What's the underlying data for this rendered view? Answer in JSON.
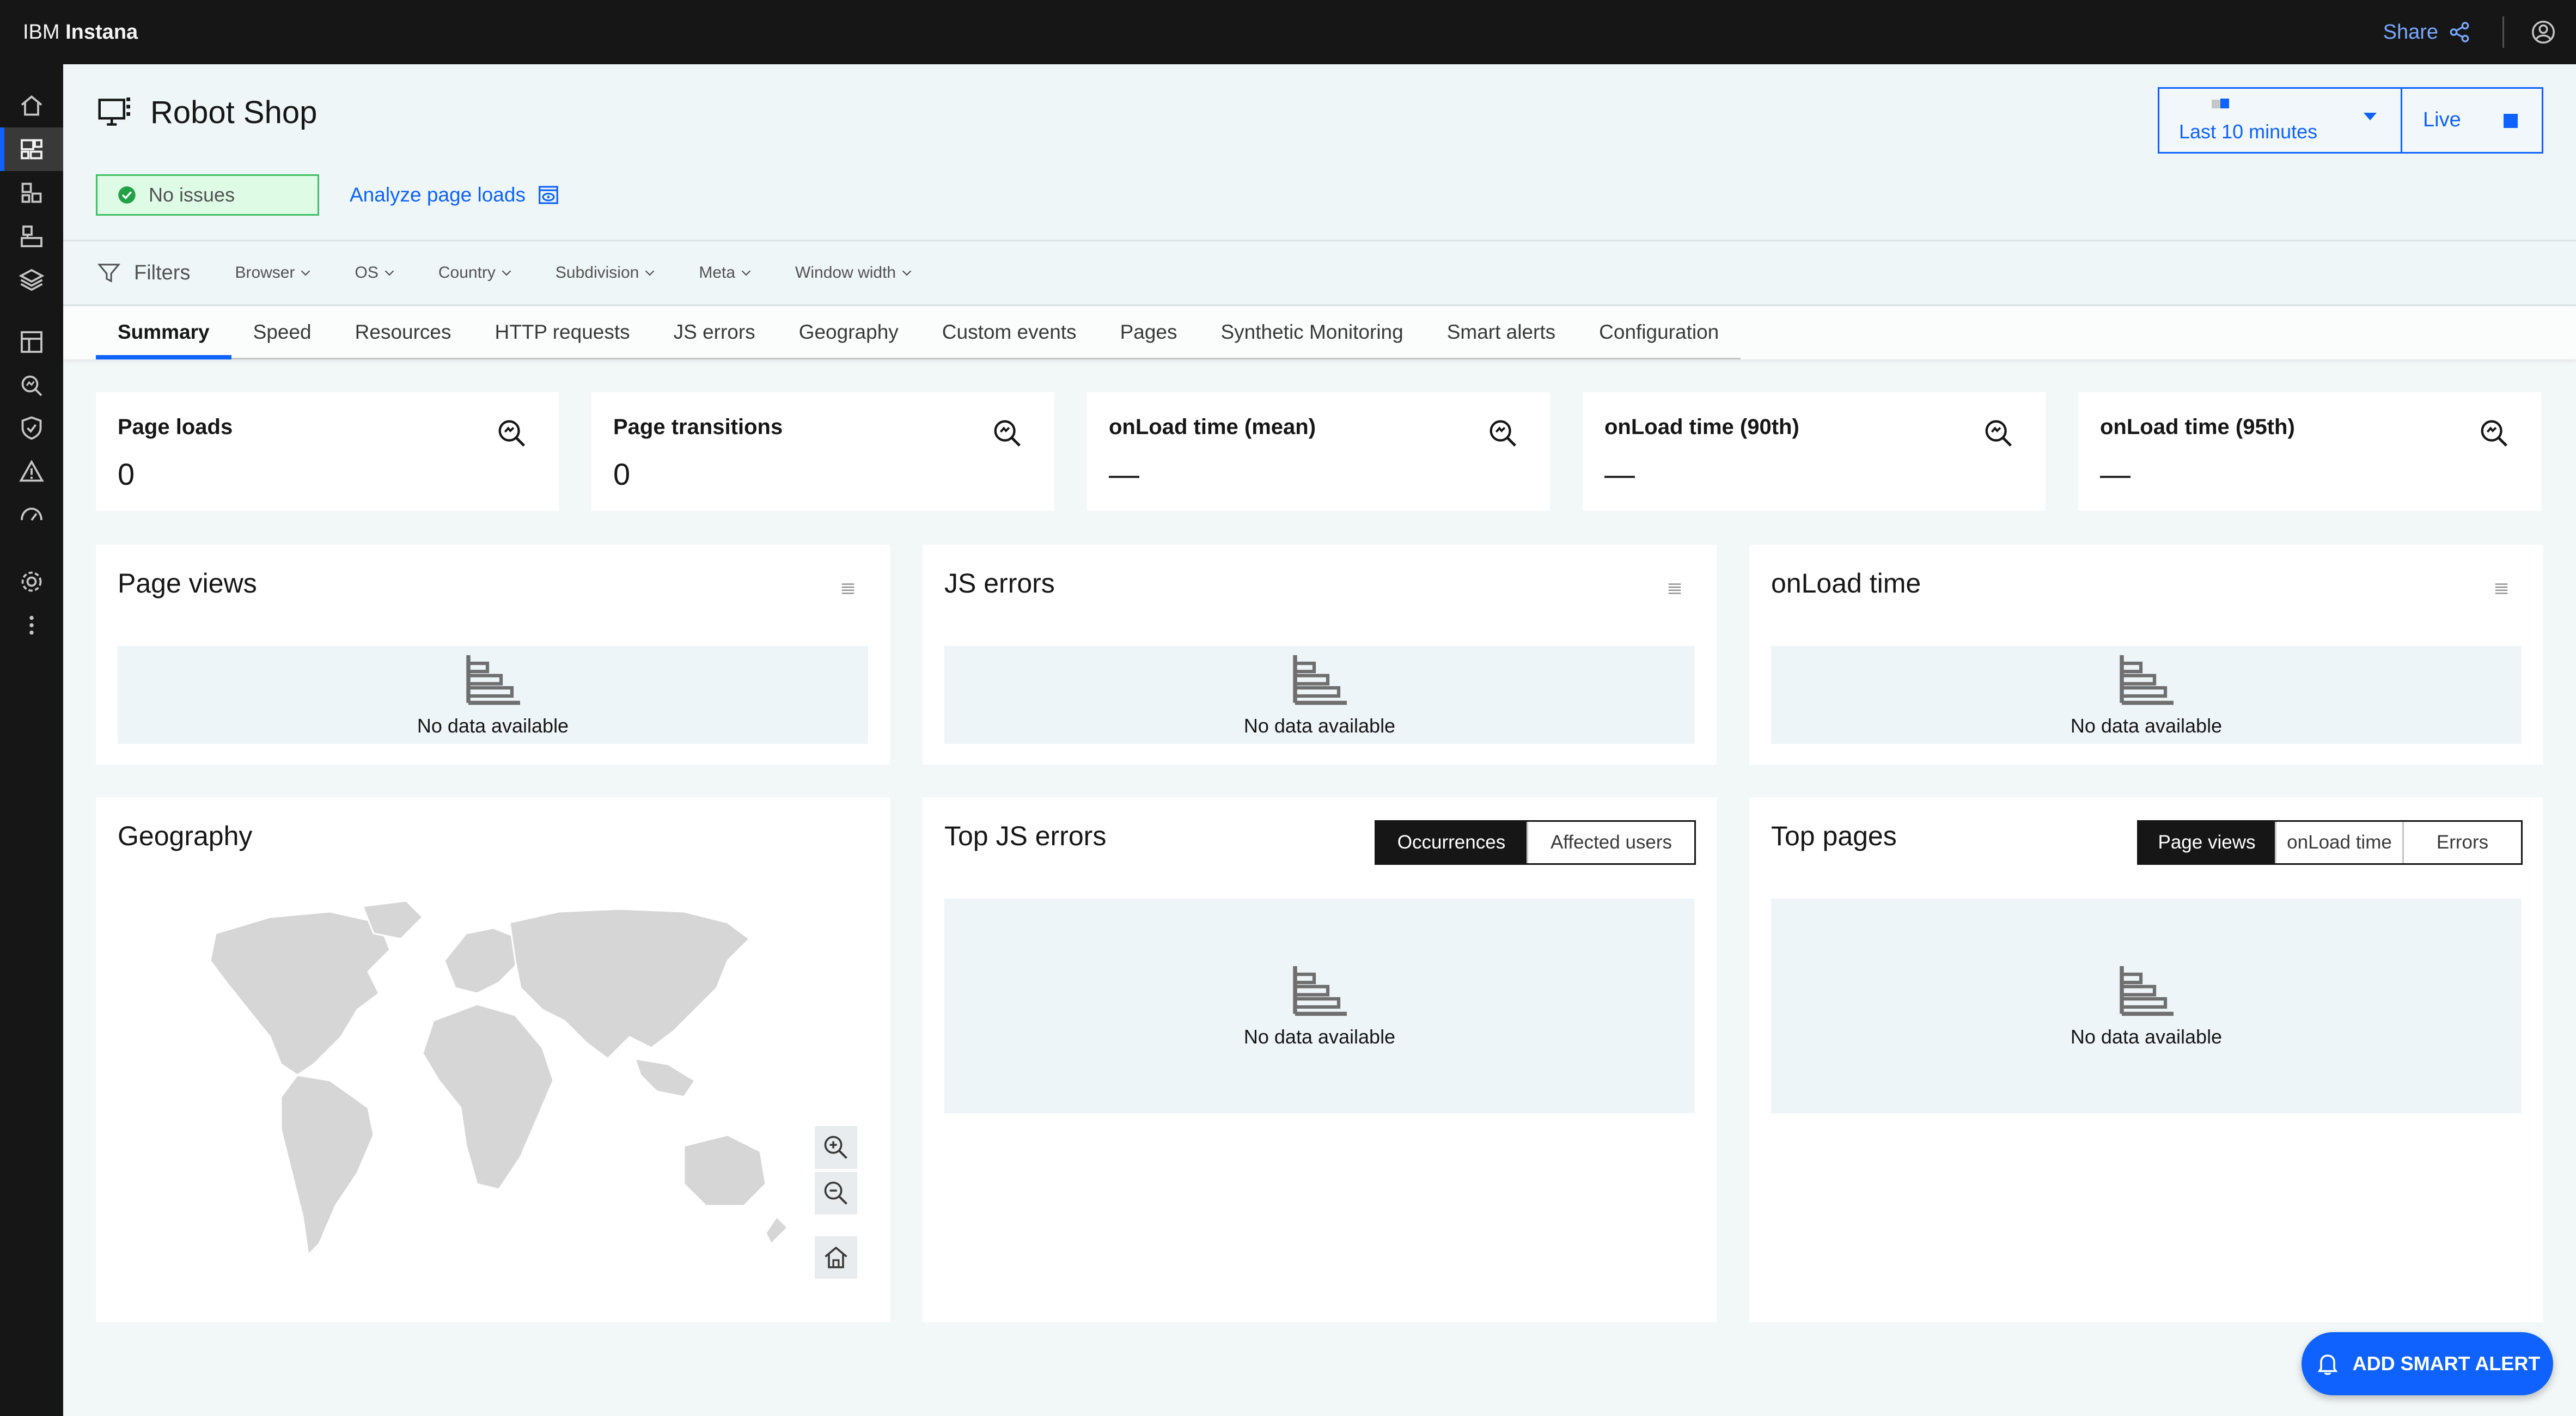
{
  "header": {
    "brand_prefix": "IBM",
    "brand_name": "Instana",
    "share_label": "Share"
  },
  "page": {
    "title": "Robot Shop",
    "status": "No issues",
    "analyze_link": "Analyze page loads"
  },
  "time_picker": {
    "range_label": "Last 10 minutes",
    "live_label": "Live"
  },
  "filters": {
    "label": "Filters",
    "dropdowns": [
      "Browser",
      "OS",
      "Country",
      "Subdivision",
      "Meta",
      "Window width"
    ]
  },
  "tabs": [
    "Summary",
    "Speed",
    "Resources",
    "HTTP requests",
    "JS errors",
    "Geography",
    "Custom events",
    "Pages",
    "Synthetic Monitoring",
    "Smart alerts",
    "Configuration"
  ],
  "kpis": [
    {
      "label": "Page loads",
      "value": "0"
    },
    {
      "label": "Page transitions",
      "value": "0"
    },
    {
      "label": "onLoad time (mean)",
      "value": "—"
    },
    {
      "label": "onLoad time (90th)",
      "value": "—"
    },
    {
      "label": "onLoad time (95th)",
      "value": "—"
    }
  ],
  "panels": {
    "page_views": {
      "title": "Page views",
      "empty": "No data available"
    },
    "js_errors": {
      "title": "JS errors",
      "empty": "No data available"
    },
    "onload_time": {
      "title": "onLoad time",
      "empty": "No data available"
    },
    "geography": {
      "title": "Geography"
    },
    "top_js_errors": {
      "title": "Top JS errors",
      "empty": "No data available",
      "options": [
        "Occurrences",
        "Affected users"
      ],
      "selected": "Occurrences"
    },
    "top_pages": {
      "title": "Top pages",
      "empty": "No data available",
      "options": [
        "Page views",
        "onLoad time",
        "Errors"
      ],
      "selected": "Page views"
    }
  },
  "fab_label": "ADD SMART ALERT",
  "colors": {
    "accent": "#0f62fe",
    "header_bg": "#161616",
    "success": "#42be65"
  }
}
